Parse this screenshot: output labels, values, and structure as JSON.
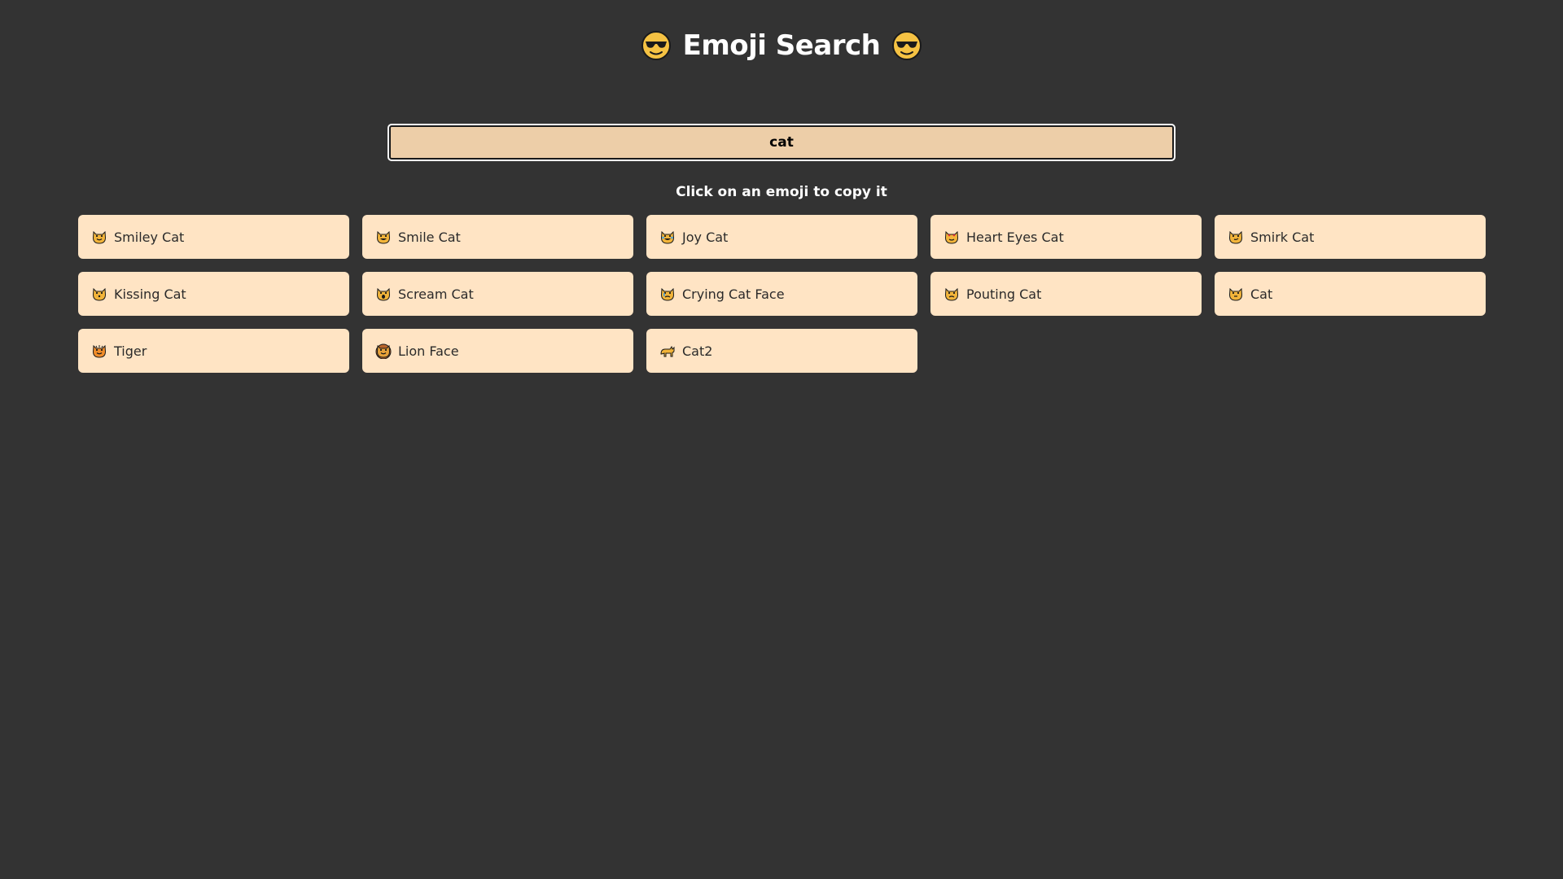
{
  "header": {
    "title": "Emoji Search",
    "left_icon": "sunglasses-face-icon",
    "right_icon": "sunglasses-face-icon"
  },
  "search": {
    "value": "cat",
    "placeholder": ""
  },
  "hint": "Click on an emoji to copy it",
  "colors": {
    "background": "#333333",
    "tile": "#ffe4c4",
    "input": "#edcea8",
    "emoji_yellow": "#f5c243"
  },
  "results": [
    {
      "label": "Smiley Cat",
      "icon": "smiley-cat-icon",
      "face": "#f2b43a",
      "mouth": "smile"
    },
    {
      "label": "Smile Cat",
      "icon": "smile-cat-icon",
      "face": "#f2b43a",
      "mouth": "grin"
    },
    {
      "label": "Joy Cat",
      "icon": "joy-cat-icon",
      "face": "#f2b43a",
      "mouth": "tears"
    },
    {
      "label": "Heart Eyes Cat",
      "icon": "heart-eyes-cat-icon",
      "face": "#f2b43a",
      "mouth": "heart"
    },
    {
      "label": "Smirk Cat",
      "icon": "smirk-cat-icon",
      "face": "#f2b43a",
      "mouth": "smirk"
    },
    {
      "label": "Kissing Cat",
      "icon": "kissing-cat-icon",
      "face": "#f2b43a",
      "mouth": "kiss"
    },
    {
      "label": "Scream Cat",
      "icon": "scream-cat-icon",
      "face": "#f2b43a",
      "mouth": "scream"
    },
    {
      "label": "Crying Cat Face",
      "icon": "crying-cat-face-icon",
      "face": "#f2b43a",
      "mouth": "cry"
    },
    {
      "label": "Pouting Cat",
      "icon": "pouting-cat-icon",
      "face": "#f2b43a",
      "mouth": "pout"
    },
    {
      "label": "Cat",
      "icon": "cat-face-icon",
      "face": "#f2b43a",
      "mouth": "plain"
    },
    {
      "label": "Tiger",
      "icon": "tiger-face-icon",
      "face": "#f08c2a",
      "mouth": "tiger"
    },
    {
      "label": "Lion Face",
      "icon": "lion-face-icon",
      "face": "#e8a23a",
      "mouth": "lion"
    },
    {
      "label": "Cat2",
      "icon": "cat-full-body-icon",
      "face": "#f2b43a",
      "mouth": "body"
    }
  ]
}
